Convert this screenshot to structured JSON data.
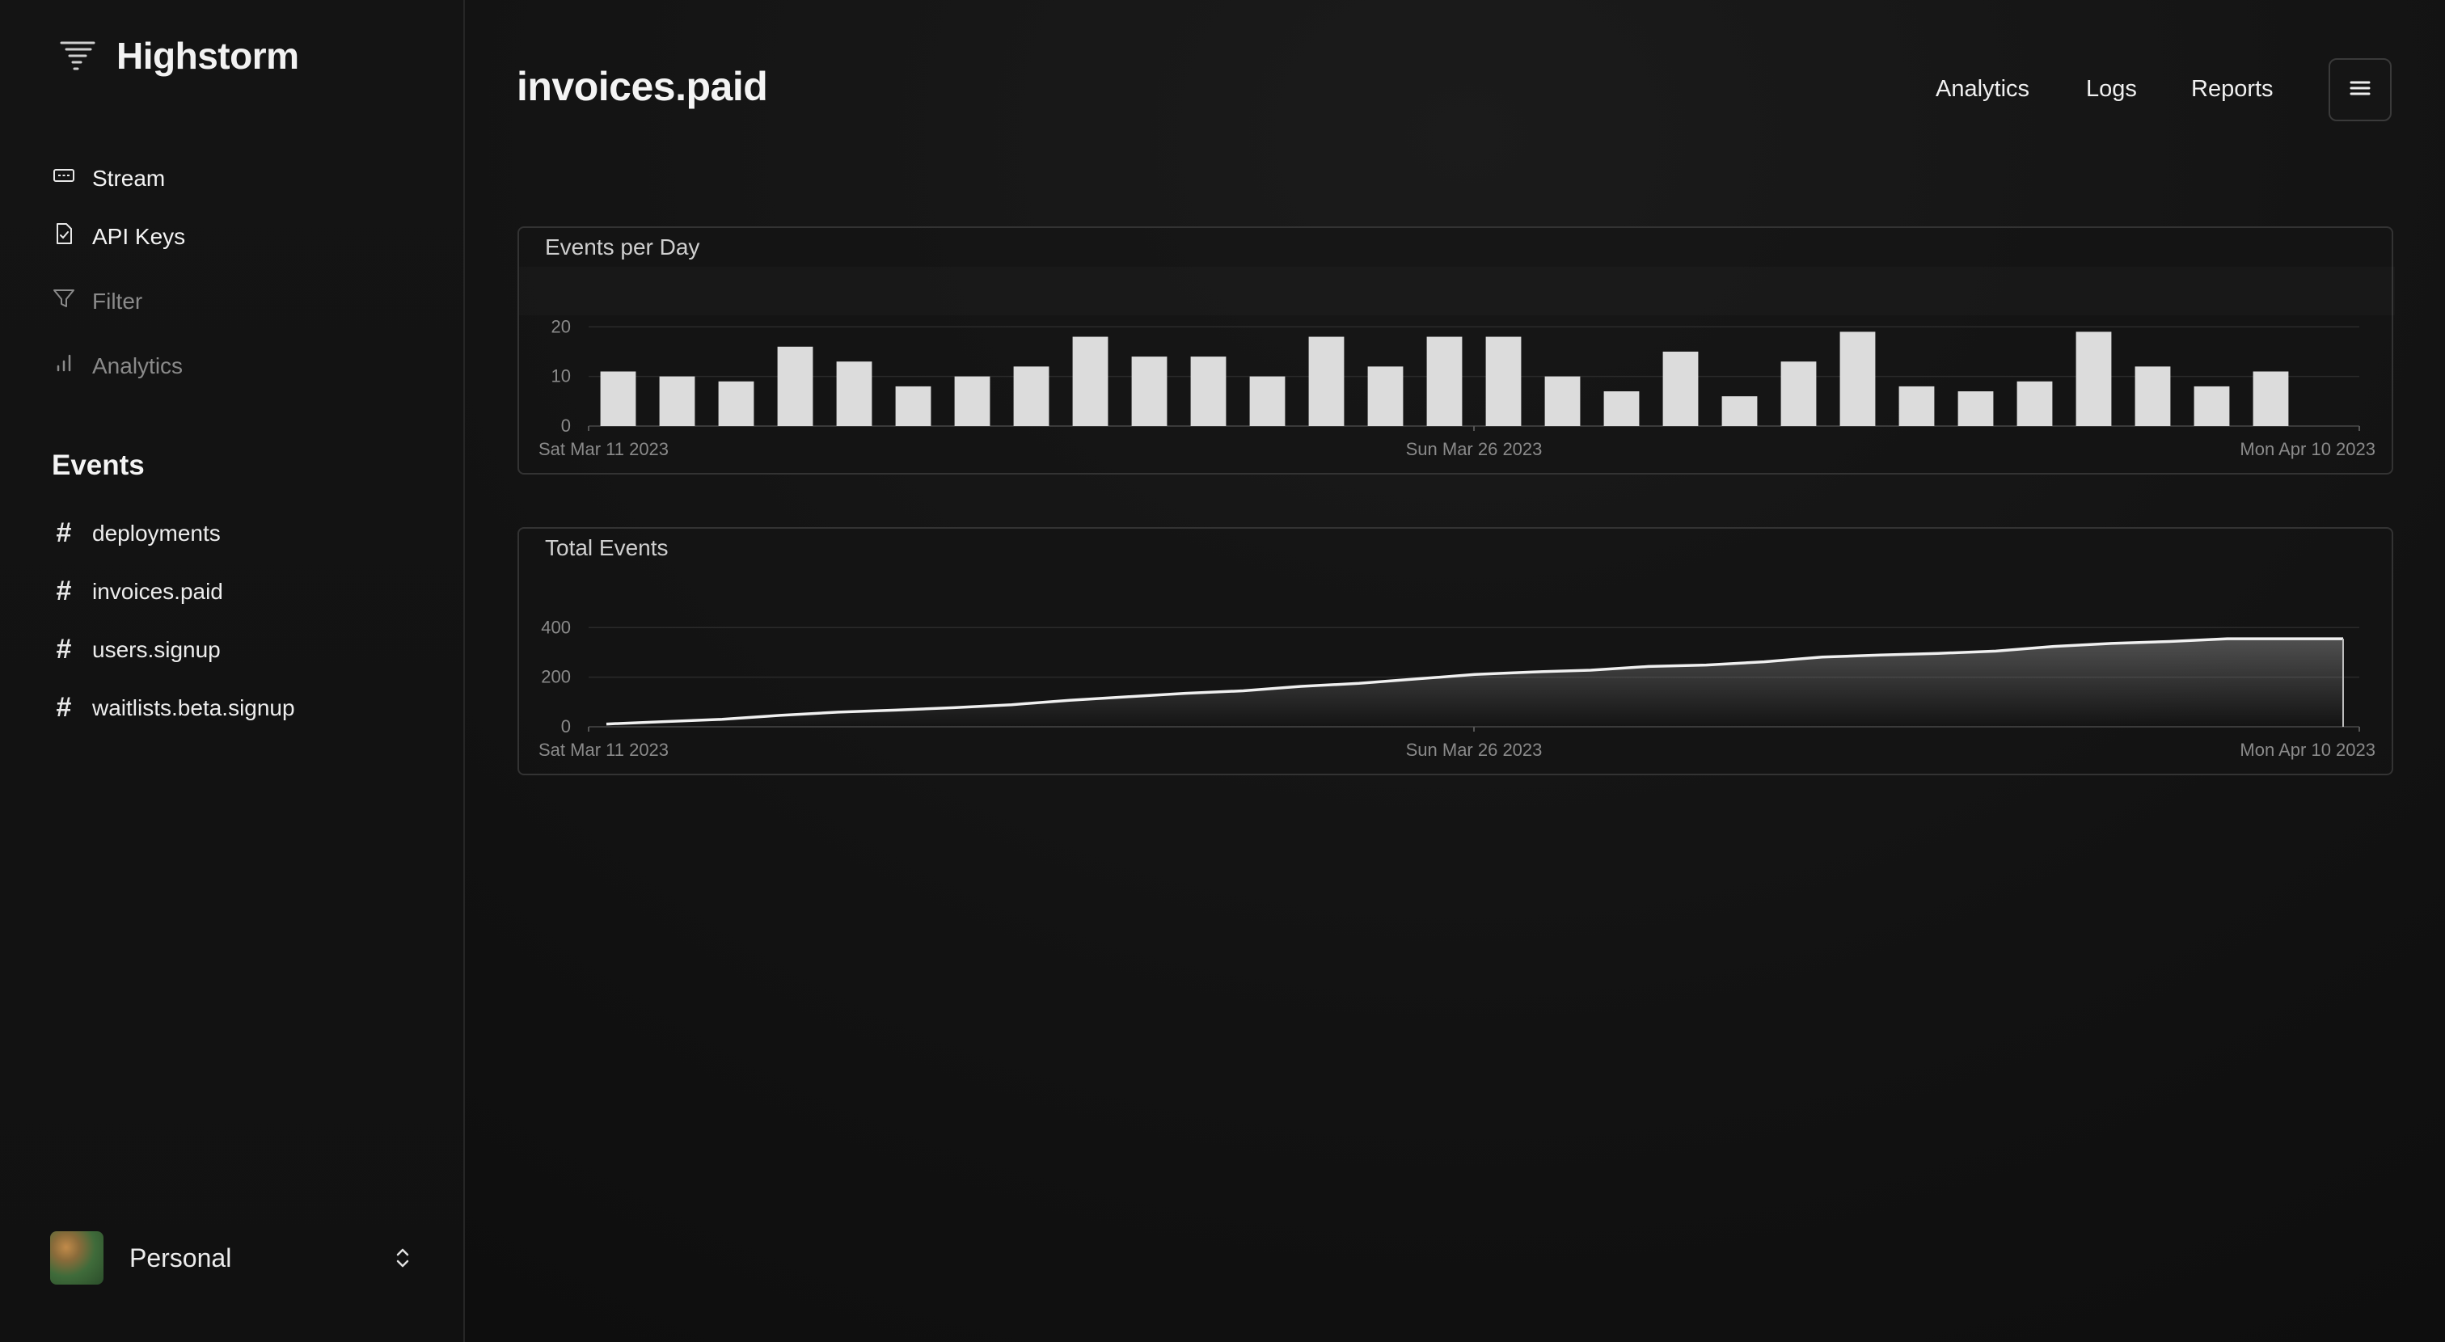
{
  "app": {
    "name": "Highstorm"
  },
  "sidebar": {
    "nav": [
      {
        "label": "Stream",
        "icon": "stream-icon"
      },
      {
        "label": "API Keys",
        "icon": "file-check-icon"
      },
      {
        "label": "Filter",
        "icon": "filter-icon"
      },
      {
        "label": "Analytics",
        "icon": "bar-chart-icon"
      }
    ],
    "events_title": "Events",
    "events": [
      {
        "label": "deployments"
      },
      {
        "label": "invoices.paid"
      },
      {
        "label": "users.signup"
      },
      {
        "label": "waitlists.beta.signup"
      }
    ],
    "account": {
      "name": "Personal"
    }
  },
  "header": {
    "title": "invoices.paid",
    "nav": [
      "Analytics",
      "Logs",
      "Reports"
    ],
    "menu_icon": "hamburger-icon"
  },
  "colors": {
    "accent": "#dcdcdc",
    "border": "#333333",
    "muted": "#8a8a8a"
  },
  "chart_data": [
    {
      "type": "bar",
      "title": "Events per Day",
      "x_tick_labels": [
        "Sat Mar 11 2023",
        "Sun Mar 26 2023",
        "Mon Apr 10 2023"
      ],
      "x_range": [
        "2023-03-11",
        "2023-04-10"
      ],
      "categories": [
        "2023-03-11",
        "2023-03-12",
        "2023-03-13",
        "2023-03-14",
        "2023-03-15",
        "2023-03-16",
        "2023-03-17",
        "2023-03-18",
        "2023-03-19",
        "2023-03-20",
        "2023-03-21",
        "2023-03-22",
        "2023-03-23",
        "2023-03-24",
        "2023-03-25",
        "2023-03-26",
        "2023-03-27",
        "2023-03-28",
        "2023-03-29",
        "2023-03-30",
        "2023-03-31",
        "2023-04-01",
        "2023-04-02",
        "2023-04-03",
        "2023-04-04",
        "2023-04-05",
        "2023-04-06",
        "2023-04-07",
        "2023-04-08",
        "2023-04-09",
        "2023-04-10"
      ],
      "values": [
        11,
        10,
        9,
        16,
        13,
        8,
        10,
        12,
        18,
        14,
        14,
        10,
        18,
        12,
        18,
        18,
        10,
        7,
        15,
        6,
        13,
        19,
        8,
        7,
        9,
        19,
        12,
        8,
        11,
        0,
        0
      ],
      "y_ticks": [
        0,
        10,
        20
      ],
      "ylim": [
        0,
        22
      ],
      "grid": true
    },
    {
      "type": "area",
      "title": "Total Events",
      "x_tick_labels": [
        "Sat Mar 11 2023",
        "Sun Mar 26 2023",
        "Mon Apr 10 2023"
      ],
      "x_range": [
        "2023-03-11",
        "2023-04-10"
      ],
      "x": [
        "2023-03-11",
        "2023-03-12",
        "2023-03-13",
        "2023-03-14",
        "2023-03-15",
        "2023-03-16",
        "2023-03-17",
        "2023-03-18",
        "2023-03-19",
        "2023-03-20",
        "2023-03-21",
        "2023-03-22",
        "2023-03-23",
        "2023-03-24",
        "2023-03-25",
        "2023-03-26",
        "2023-03-27",
        "2023-03-28",
        "2023-03-29",
        "2023-03-30",
        "2023-03-31",
        "2023-04-01",
        "2023-04-02",
        "2023-04-03",
        "2023-04-04",
        "2023-04-05",
        "2023-04-06",
        "2023-04-07",
        "2023-04-08",
        "2023-04-09",
        "2023-04-10"
      ],
      "values": [
        11,
        21,
        30,
        46,
        59,
        67,
        77,
        89,
        107,
        121,
        135,
        145,
        163,
        175,
        193,
        211,
        221,
        228,
        243,
        249,
        262,
        281,
        289,
        296,
        305,
        324,
        336,
        344,
        355,
        355,
        355
      ],
      "y_ticks": [
        0,
        200,
        400
      ],
      "ylim": [
        0,
        440
      ],
      "grid": true
    }
  ]
}
